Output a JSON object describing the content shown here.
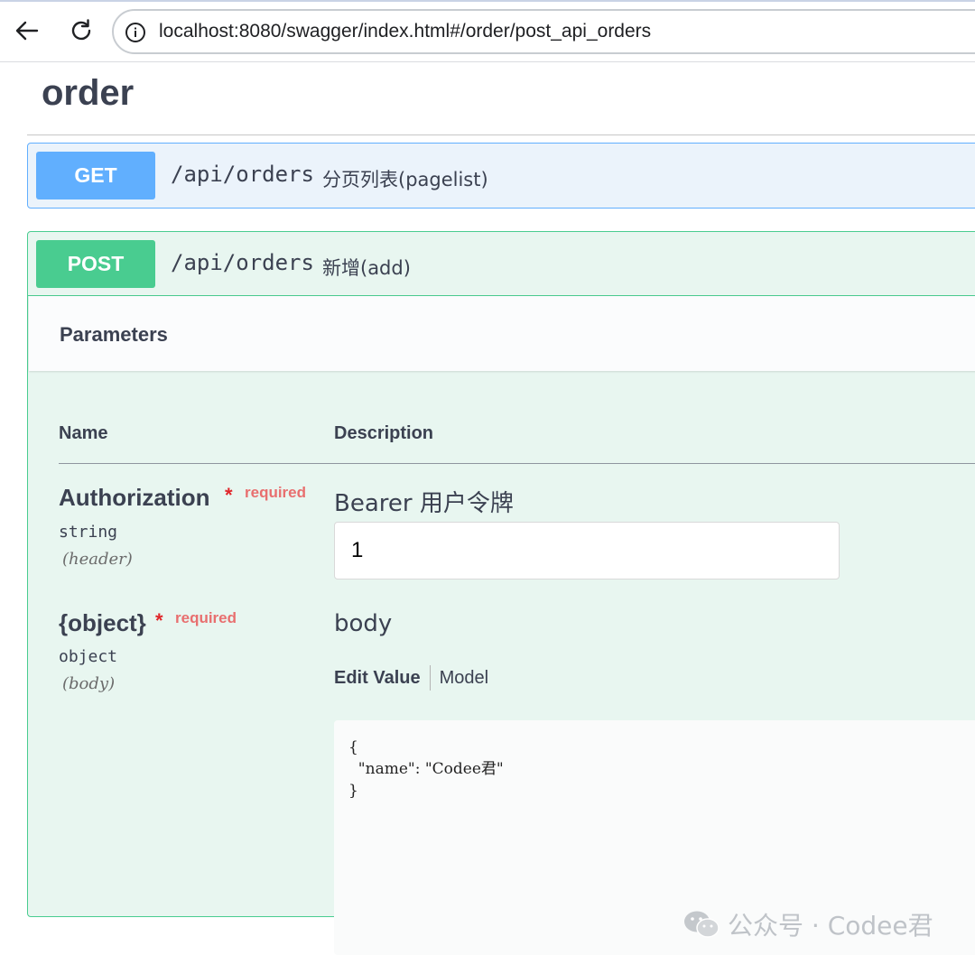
{
  "browser": {
    "url": "localhost:8080/swagger/index.html#/order/post_api_orders"
  },
  "tag": {
    "title": "order"
  },
  "operations": [
    {
      "method": "GET",
      "path": "/api/orders",
      "summary": "分页列表(pagelist)"
    },
    {
      "method": "POST",
      "path": "/api/orders",
      "summary": "新增(add)"
    }
  ],
  "parameters": {
    "title": "Parameters",
    "col_name": "Name",
    "col_description": "Description",
    "items": [
      {
        "name": "Authorization",
        "star": "*",
        "required_label": "required",
        "type": "string",
        "in": "(header)",
        "description": "Bearer 用户令牌",
        "value": "1"
      },
      {
        "name": "{object}",
        "star": "*",
        "required_label": "required",
        "type": "object",
        "in": "(body)",
        "description": "body",
        "tabs": [
          "Edit Value",
          "Model"
        ],
        "body_value": "{\n  \"name\": \"Codee君\"\n}"
      }
    ]
  },
  "watermark": {
    "text": "公众号 · Codee君"
  },
  "colors": {
    "get": "#61affe",
    "post": "#49cc90",
    "required": "#e0262a"
  }
}
